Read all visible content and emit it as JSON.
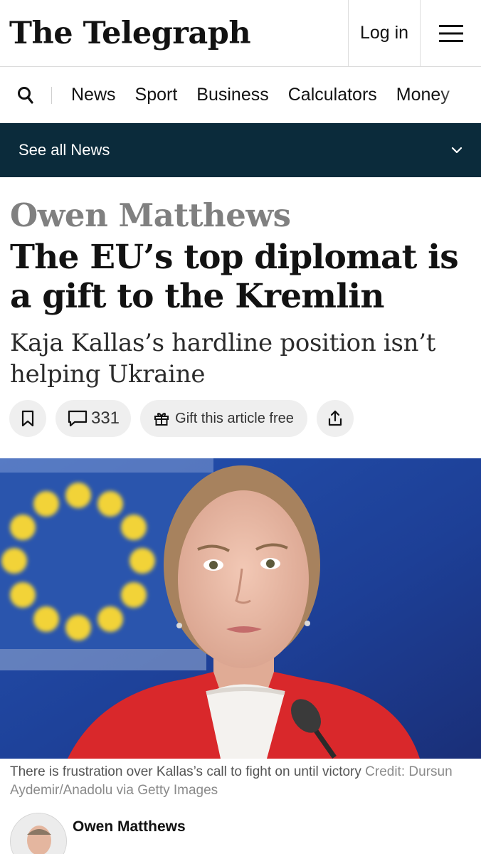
{
  "header": {
    "logo_text": "The Telegraph",
    "login_label": "Log in",
    "menu_icon": "hamburger-menu-icon"
  },
  "nav": {
    "search_icon": "search-icon",
    "items": [
      "News",
      "Sport",
      "Business",
      "Calculators",
      "Money"
    ]
  },
  "section_bar": {
    "label": "See all News",
    "chevron_icon": "chevron-down-icon",
    "background": "#0b2b3b"
  },
  "article": {
    "author_kicker": "Owen Matthews",
    "headline": "The EU’s top diplomat is a gift to the Kremlin",
    "standfirst": "Kaja Kallas’s hardline position isn’t helping Ukraine",
    "comment_count": "331",
    "gift_label": "Gift this article free",
    "caption": "There is frustration over Kallas’s call to fight on until victory",
    "credit_label": "Credit:",
    "credit_text": "Dursun Aydemir/Anadolu via Getty Images",
    "byline_name": "Owen Matthews"
  },
  "colors": {
    "kicker_grey": "#808080",
    "eu_blue": "#1a3f93",
    "eu_star_yellow": "#f2d338",
    "jacket_red": "#d9282b"
  }
}
